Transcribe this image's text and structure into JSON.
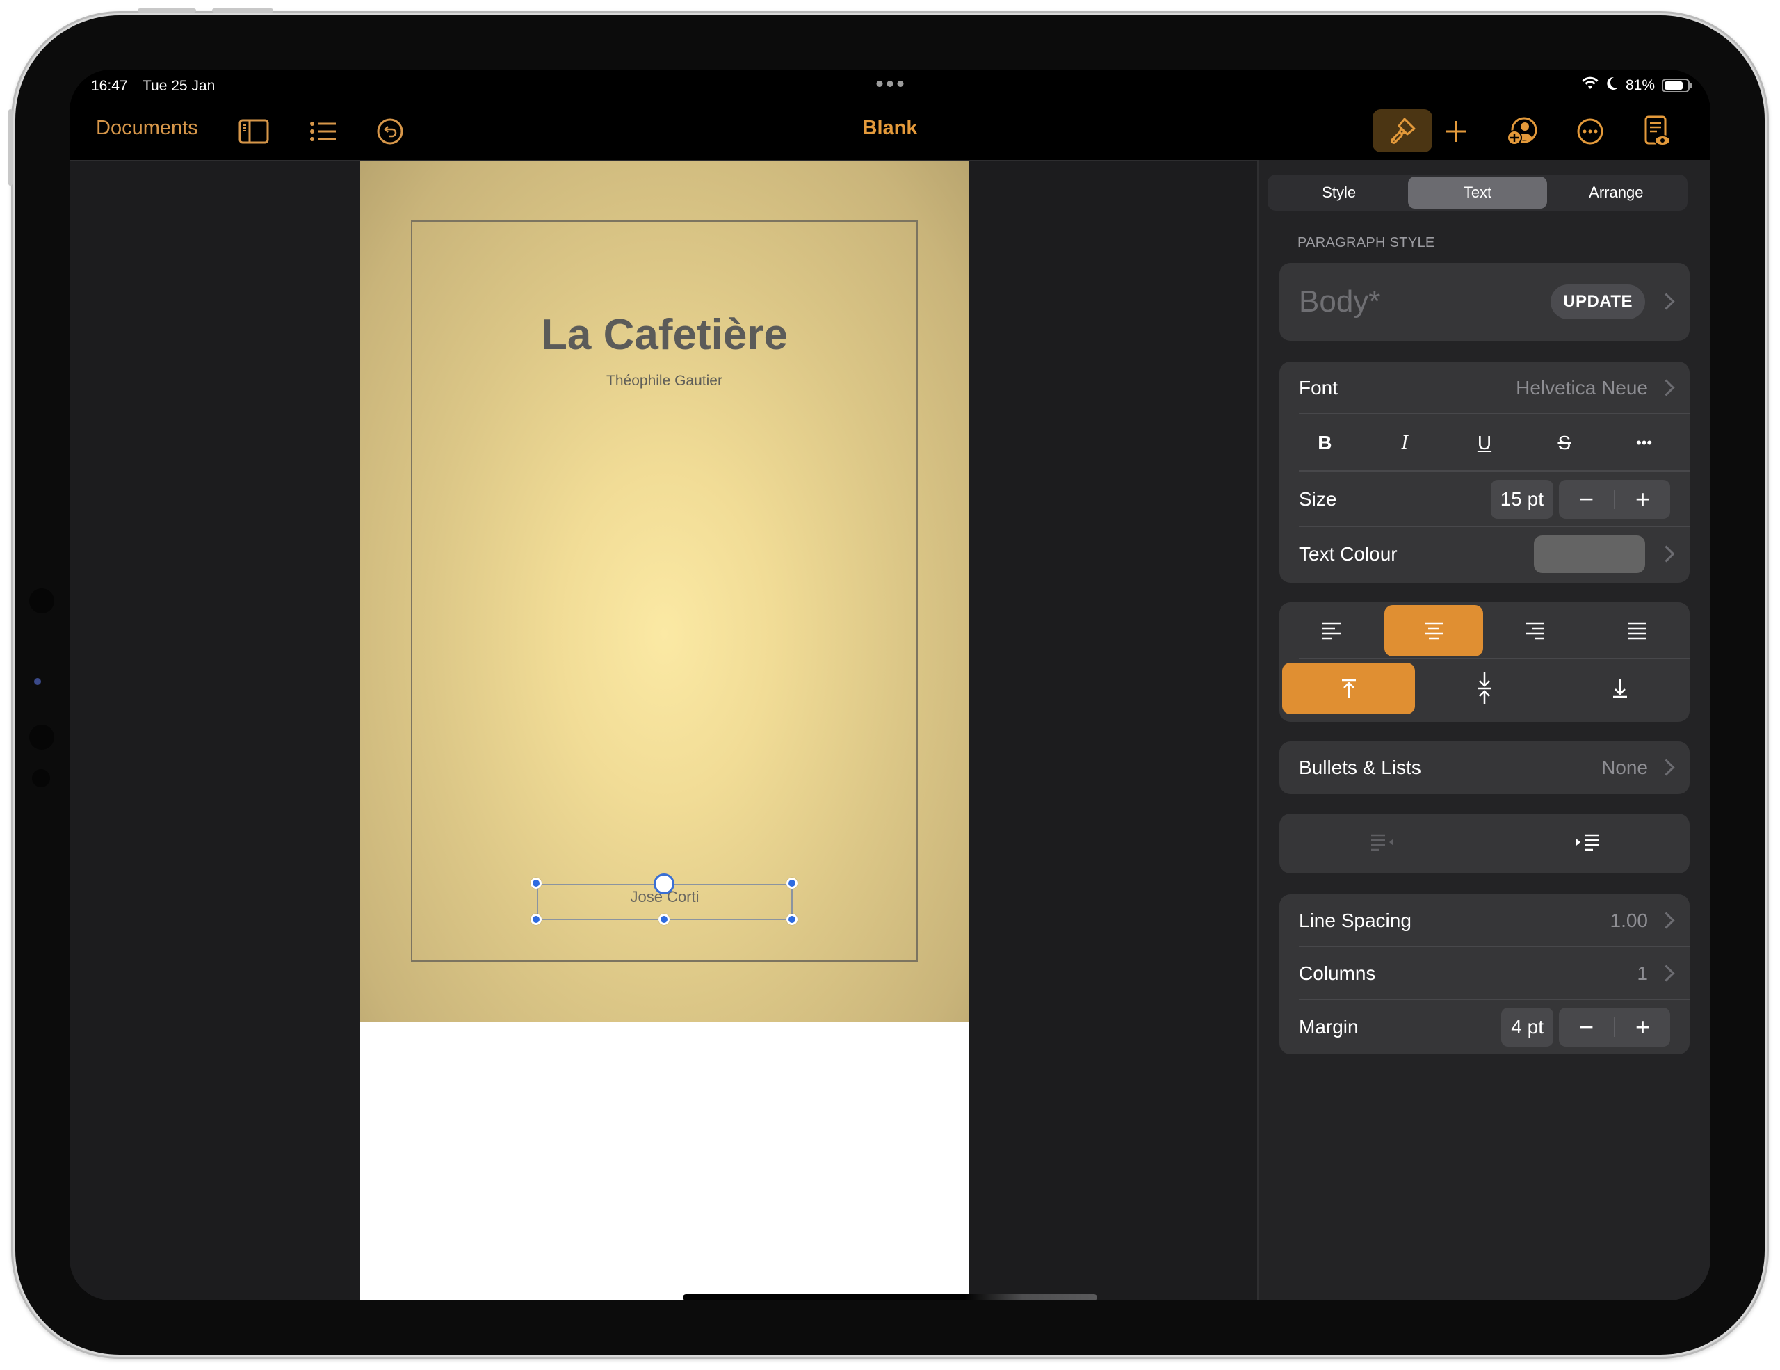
{
  "status_bar": {
    "time": "16:47",
    "date": "Tue 25 Jan",
    "battery_percent": "81%",
    "battery_level": 0.81,
    "icons": [
      "wifi-icon",
      "moon-icon",
      "battery-icon"
    ]
  },
  "toolbar": {
    "documents_label": "Documents",
    "title": "Blank",
    "left_icons": [
      "sidebar-icon",
      "list-icon",
      "undo-icon"
    ],
    "right_icons": [
      "paintbrush-icon",
      "plus-icon",
      "collaborate-icon",
      "more-icon",
      "reading-view-icon"
    ],
    "accent_color": "#E49A3B"
  },
  "document": {
    "title": "La Cafetière",
    "author": "Théophile Gautier",
    "selected_text": "Jose Corti"
  },
  "inspector": {
    "tabs": [
      {
        "label": "Style",
        "active": false
      },
      {
        "label": "Text",
        "active": true
      },
      {
        "label": "Arrange",
        "active": false
      }
    ],
    "paragraph_style": {
      "section_label": "PARAGRAPH STYLE",
      "value": "Body*",
      "update_label": "UPDATE"
    },
    "font": {
      "label": "Font",
      "value": "Helvetica Neue"
    },
    "format_buttons": [
      {
        "label": "B",
        "name": "bold"
      },
      {
        "label": "I",
        "name": "italic"
      },
      {
        "label": "U",
        "name": "underline"
      },
      {
        "label": "S",
        "name": "strikethrough"
      },
      {
        "label": "•••",
        "name": "more-text-options"
      }
    ],
    "size": {
      "label": "Size",
      "value": "15 pt",
      "minus": "−",
      "plus": "+"
    },
    "text_colour": {
      "label": "Text Colour",
      "swatch": "#646464"
    },
    "alignment": {
      "options": [
        "left",
        "center",
        "right",
        "justify"
      ],
      "selected": "center"
    },
    "vertical_alignment": {
      "options": [
        "top",
        "middle",
        "bottom"
      ],
      "selected": "top"
    },
    "bullets": {
      "label": "Bullets & Lists",
      "value": "None"
    },
    "indent": {
      "decrease_enabled": false,
      "increase_enabled": true
    },
    "line_spacing": {
      "label": "Line Spacing",
      "value": "1.00"
    },
    "columns": {
      "label": "Columns",
      "value": "1"
    },
    "margin": {
      "label": "Margin",
      "value": "4 pt",
      "minus": "−",
      "plus": "+"
    },
    "selected_color": "#E08F32"
  }
}
